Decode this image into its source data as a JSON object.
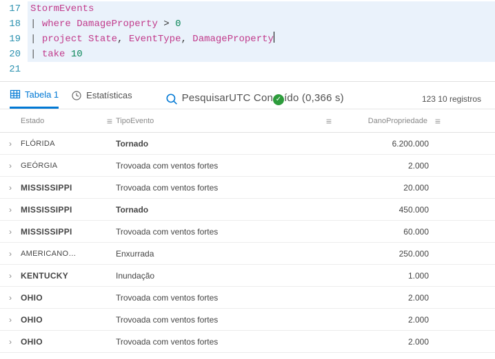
{
  "editor": {
    "lines": [
      {
        "num": "17",
        "hl": true,
        "tokens": [
          {
            "cls": "tok-table",
            "t": "StormEvents"
          }
        ]
      },
      {
        "num": "18",
        "hl": true,
        "tokens": [
          {
            "cls": "tok-pipe",
            "t": "| "
          },
          {
            "cls": "tok-kw",
            "t": "where "
          },
          {
            "cls": "tok-field",
            "t": "DamageProperty"
          },
          {
            "cls": "tok-op",
            "t": " > "
          },
          {
            "cls": "tok-num",
            "t": "0"
          }
        ]
      },
      {
        "num": "19",
        "hl": true,
        "tokens": [
          {
            "cls": "tok-pipe",
            "t": "| "
          },
          {
            "cls": "tok-kw",
            "t": "project "
          },
          {
            "cls": "tok-field",
            "t": "State"
          },
          {
            "cls": "tok-op",
            "t": ", "
          },
          {
            "cls": "tok-field",
            "t": "EventType"
          },
          {
            "cls": "tok-op",
            "t": ", "
          },
          {
            "cls": "tok-field",
            "t": "DamageProperty"
          }
        ],
        "cursor": true
      },
      {
        "num": "20",
        "hl": true,
        "tokens": [
          {
            "cls": "tok-pipe",
            "t": "| "
          },
          {
            "cls": "tok-kw",
            "t": "take "
          },
          {
            "cls": "tok-num",
            "t": "10"
          }
        ]
      },
      {
        "num": "21",
        "hl": false,
        "tokens": []
      }
    ]
  },
  "toolbar": {
    "tab_table": "Tabela 1",
    "tab_stats": "Estatísticas",
    "search_left": "Pesquisar",
    "search_mid": "UTC Con",
    "search_right": "ído (0,366 s)",
    "records": "123 10 registros"
  },
  "columns": {
    "state": "Estado",
    "event": "TipoEvento",
    "damage": "DanoPropriedade",
    "menu_glyph": "≡"
  },
  "rows": [
    {
      "state": "FLÓRIDA",
      "state_bold": false,
      "event": "Tornado",
      "event_bold": true,
      "dmg": "6.200.000"
    },
    {
      "state": "GEÓRGIA",
      "state_bold": false,
      "event": "Trovoada com ventos fortes",
      "event_bold": false,
      "dmg": "2.000"
    },
    {
      "state": "MISSISSIPPI",
      "state_bold": true,
      "event": "Trovoada com ventos fortes",
      "event_bold": false,
      "dmg": "20.000"
    },
    {
      "state": "MISSISSIPPI",
      "state_bold": true,
      "event": "Tornado",
      "event_bold": true,
      "dmg": "450.000"
    },
    {
      "state": "MISSISSIPPI",
      "state_bold": true,
      "event": "Trovoada com ventos fortes",
      "event_bold": false,
      "dmg": "60.000"
    },
    {
      "state": "AMERICANO…",
      "state_bold": false,
      "event": "Enxurrada",
      "event_bold": false,
      "dmg": "250.000"
    },
    {
      "state": "KENTUCKY",
      "state_bold": true,
      "event": "Inundação",
      "event_bold": false,
      "dmg": "1.000"
    },
    {
      "state": "OHIO",
      "state_bold": true,
      "event": "Trovoada com ventos fortes",
      "event_bold": false,
      "dmg": "2.000"
    },
    {
      "state": "OHIO",
      "state_bold": true,
      "event": "Trovoada com ventos fortes",
      "event_bold": false,
      "dmg": "2.000"
    },
    {
      "state": "OHIO",
      "state_bold": true,
      "event": "Trovoada com ventos fortes",
      "event_bold": false,
      "dmg": "2.000"
    }
  ],
  "glyphs": {
    "chevron": "›"
  }
}
